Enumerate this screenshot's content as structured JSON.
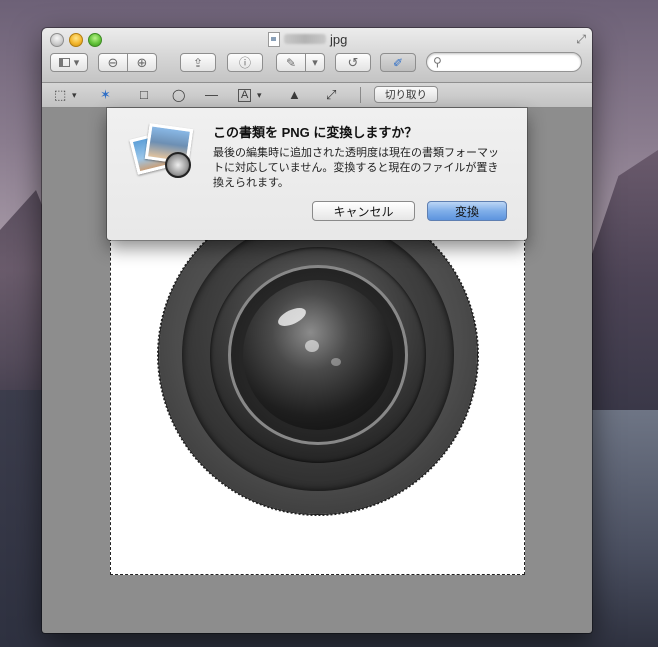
{
  "window": {
    "title_suffix": "jpg",
    "fullscreen_icon": "expand-arrows-icon"
  },
  "toolbar": {
    "sidebar_icon": "sidebar-icon",
    "dropdown_glyph": "▾",
    "zoom_out_glyph": "⊖",
    "zoom_in_glyph": "⊕",
    "share_glyph": "⇪",
    "info_glyph": "ⓘ",
    "annotate_glyph": "✎",
    "rotate_glyph": "↺",
    "edit_glyph": "✐",
    "search_placeholder": ""
  },
  "edit_bar": {
    "select_glyph": "⬚",
    "instant_alpha_glyph": "✶",
    "rect_glyph": "□",
    "oval_glyph": "◯",
    "line_glyph": "—",
    "text_glyph": "A",
    "adjust_color_glyph": "▲",
    "resize_glyph": "⤢",
    "crop_label": "切り取り"
  },
  "dialog": {
    "title": "この書類を PNG に変換しますか？",
    "message": "最後の編集時に追加された透明度は現在の書類フォーマットに対応していません。変換すると現在のファイルが置き換えられます。",
    "cancel_label": "キャンセル",
    "convert_label": "変換"
  }
}
